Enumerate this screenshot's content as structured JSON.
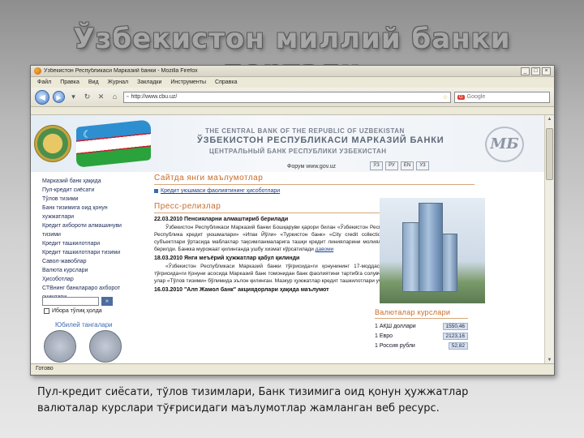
{
  "slide": {
    "title": "Ўзбекистон миллий банки портали",
    "caption_line1": "Пул-кредит сиёсати, тўлов тизимлари, Банк тизимига оид қонун ҳужжатлар",
    "caption_line2": "валюталар курслари тўғрисидаги маълумотлар жамланган веб ресурс."
  },
  "browser": {
    "window_title": "Ўзбекистон Республикаси Марказий банки - Mozilla Firefox",
    "window_buttons": [
      "_",
      "□",
      "×"
    ],
    "menu": [
      "Файл",
      "Правка",
      "Вид",
      "Журнал",
      "Закладки",
      "Инструменты",
      "Справка"
    ],
    "url": "http://www.cbu.uz/",
    "search_placeholder": "Google",
    "status": "Готово"
  },
  "site": {
    "name_en": "THE CENTRAL BANK OF THE REPUBLIC OF UZBEKISTAN",
    "name_uz": "ЎЗБЕКИСТОН РЕСПУБЛИКАСИ МАРКАЗИЙ БАНКИ",
    "name_ru": "ЦЕНТРАЛЬНЫЙ БАНК РЕСПУБЛИКИ УЗБЕКИСТАН",
    "logo_text": "МБ",
    "forum_text": "Форум  www.gov.uz",
    "languages": [
      "ЎЗ",
      "РУ",
      "EN",
      "УЗ"
    ],
    "sidebar_links": [
      "Марказий банк ҳақида",
      "Пул-кредит сиёсати",
      "Тўлов тизими",
      "Банк тизимига оид қонун",
      "хужжатлари",
      "Кредит ахбороти алмашинуви",
      "тизими",
      "Кредит ташкилотлари",
      "Кредит ташкилотлари тизими",
      "Савол-жавоблар",
      "Валюта курслари",
      "Ҳисоботлар",
      "СТВнинг банклараро ахборот",
      "очиқлари"
    ],
    "search_button": "»",
    "search_option": "Ибора тўлиқ ҳолда",
    "shop_link": "Юбилей тангалари",
    "announcements_title": "Сайтда янги маълумотлар",
    "announcement_link": "Кредит уюшмаси фаолиятининг ҳисоботлари",
    "press_title": "Пресс-релизлар",
    "news": [
      {
        "head": "22.03.2010 Пенсияларни алмаштириб берилади",
        "body": "Ўзбекистон Республикаси Марказий банки Бошқаруви қарори билан «Ўзбекистон Республикаси Марказий банки ҳузуридаги Республика кредит уюшмалари» «Ипак Йўли» «Туркистон банк» «City credit collection» ва «Kredit savdo» тадбиркорлик субъектлари ўртасида маблағлар тақсимланмаларига ташқи кредит линияларини молиялаштириш тартиби тўғрисидаги низом берилди. Банкка мурожаат қилинганда ушбу хизмат кўрсатилади",
        "more": "давоми"
      },
      {
        "head": "18.03.2010 Янги меъёрий ҳужжатлар қабул қилинди",
        "body": "«Ўзбекистон Республикаси Марказий банки тўғрисида»ги қонунининг 17-моддаси ва «Банклар ва банк фаолияти тўғрисида»ги Қонуни асосида Марказий банк томонидан банк фаолиятини тартибга солувчи меъёрий ҳужжатлар қабул қилинди, улар «Тўлов тизими» бўлимида эълон қилинган. Мазкур ҳужжатлар кредит ташкилотлари учун мажбурийдир",
        "more": ""
      },
      {
        "head": "16.03.2010 \"Алп Жамол банк\" акциядорлари ҳақида маълумот",
        "body": "",
        "more": ""
      }
    ],
    "rates_title": "Валюталар курслари",
    "rates": [
      {
        "label": "1 АҚШ доллари",
        "value": "1550,46"
      },
      {
        "label": "1 Евро",
        "value": "2123,16"
      },
      {
        "label": "1 Россия рубли",
        "value": "52,82"
      }
    ]
  }
}
